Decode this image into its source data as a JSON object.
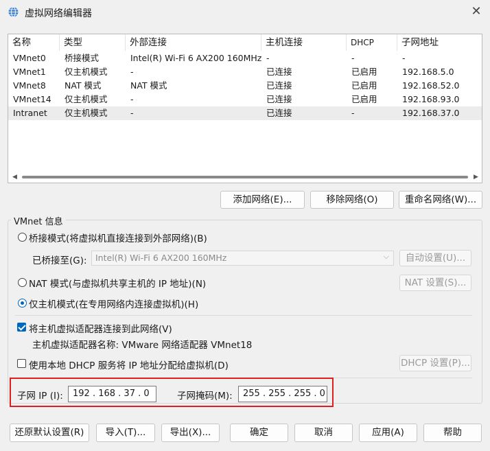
{
  "window": {
    "title": "虚拟网络编辑器",
    "close_glyph": "✕"
  },
  "table": {
    "columns": [
      "名称",
      "类型",
      "外部连接",
      "主机连接",
      "DHCP",
      "子网地址"
    ],
    "rows": [
      [
        "VMnet0",
        "桥接模式",
        "Intel(R) Wi-Fi 6 AX200 160MHz",
        "-",
        "-",
        "-"
      ],
      [
        "VMnet1",
        "仅主机模式",
        "-",
        "已连接",
        "已启用",
        "192.168.5.0"
      ],
      [
        "VMnet8",
        "NAT 模式",
        "NAT 模式",
        "已连接",
        "已启用",
        "192.168.52.0"
      ],
      [
        "VMnet14",
        "仅主机模式",
        "-",
        "已连接",
        "已启用",
        "192.168.93.0"
      ],
      [
        "Intranet",
        "仅主机模式",
        "-",
        "已连接",
        "-",
        "192.168.37.0"
      ]
    ],
    "selected_row": 4
  },
  "list_buttons": {
    "add": "添加网络(E)...",
    "remove": "移除网络(O)",
    "rename": "重命名网络(W)..."
  },
  "vmnet_info": {
    "group_label": "VMnet 信息",
    "bridged_radio": "桥接模式(将虚拟机直接连接到外部网络)(B)",
    "bridged_to_label": "已桥接至(G):",
    "bridged_to_value": "Intel(R) Wi-Fi 6 AX200 160MHz",
    "auto_settings": "自动设置(U)...",
    "nat_radio": "NAT 模式(与虚拟机共享主机的 IP 地址)(N)",
    "nat_settings": "NAT 设置(S)...",
    "hostonly_radio": "仅主机模式(在专用网络内连接虚拟机)(H)",
    "selected_mode": "hostonly",
    "connect_adapter_check": "将主机虚拟适配器连接到此网络(V)",
    "connect_adapter_checked": true,
    "adapter_name_label": "主机虚拟适配器名称: VMware 网络适配器 VMnet18",
    "dhcp_check": "使用本地 DHCP 服务将 IP 地址分配给虚拟机(D)",
    "dhcp_checked": false,
    "dhcp_settings": "DHCP 设置(P)...",
    "subnet_ip_label": "子网 IP (I):",
    "subnet_ip_value": "192 . 168 . 37 . 0",
    "subnet_mask_label": "子网掩码(M):",
    "subnet_mask_value": "255 . 255 . 255 . 0"
  },
  "footer_buttons": {
    "restore": "还原默认设置(R)",
    "import": "导入(T)...",
    "export": "导出(X)...",
    "ok": "确定",
    "cancel": "取消",
    "apply": "应用(A)",
    "help": "帮助"
  },
  "colors": {
    "accent": "#0067c0",
    "highlight_box": "#e01e1e"
  }
}
